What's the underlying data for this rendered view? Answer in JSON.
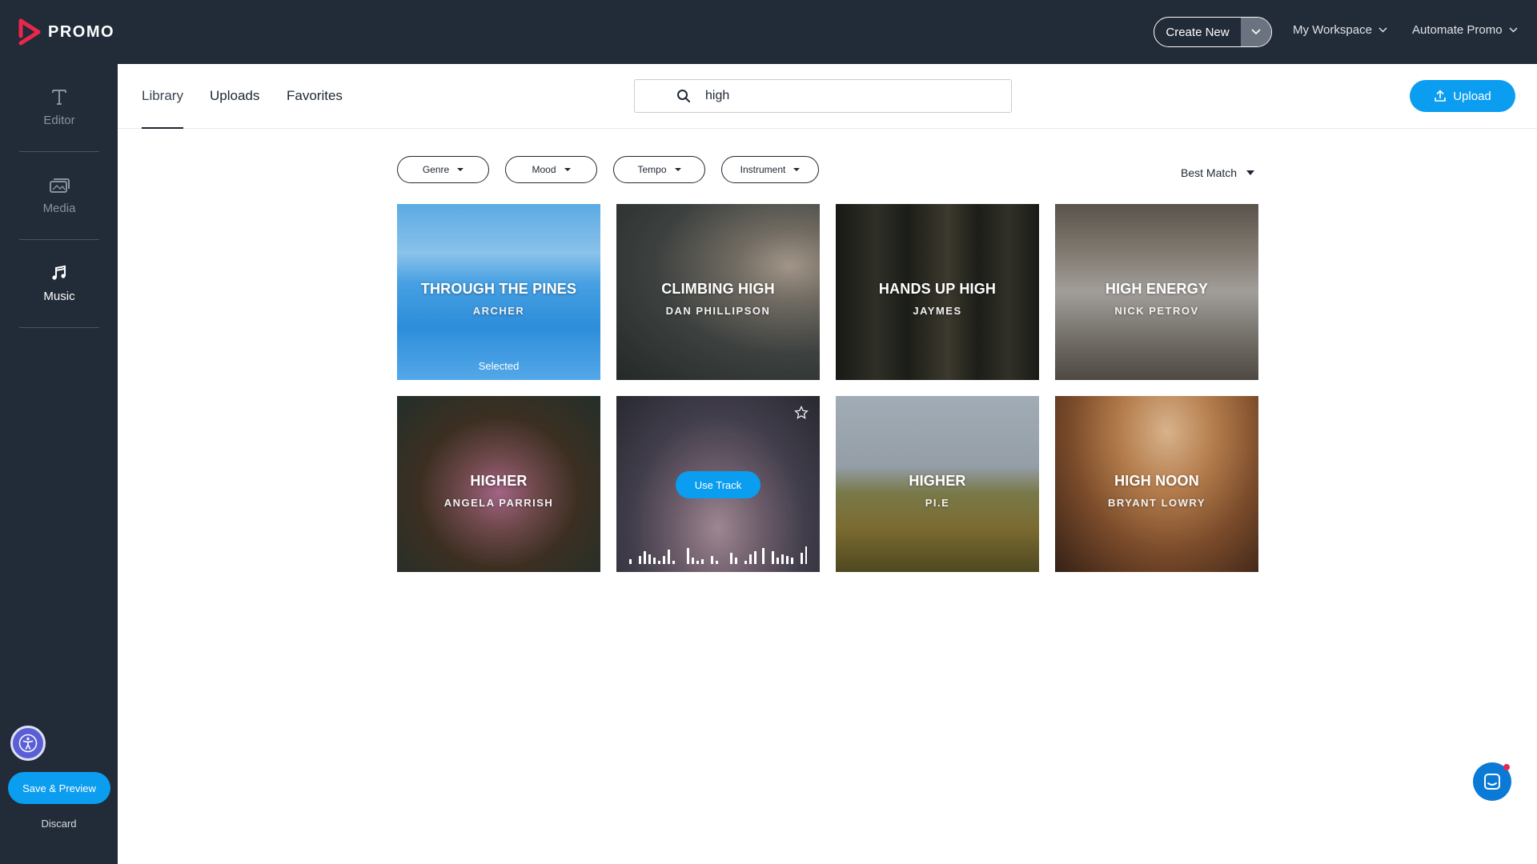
{
  "app": {
    "logo_text": "PROMO"
  },
  "topbar": {
    "create_new": "Create New",
    "workspace": "My Workspace",
    "automate": "Automate Promo"
  },
  "sidebar": {
    "items": [
      {
        "label": "Editor",
        "icon": "text-icon"
      },
      {
        "label": "Media",
        "icon": "media-icon"
      },
      {
        "label": "Music",
        "icon": "music-note-icon"
      }
    ],
    "save_preview": "Save & Preview",
    "discard": "Discard"
  },
  "header": {
    "tabs": [
      "Library",
      "Uploads",
      "Favorites"
    ],
    "active_tab": "Library",
    "search_value": "high",
    "upload": "Upload"
  },
  "filters": {
    "items": [
      "Genre",
      "Mood",
      "Tempo",
      "Instrument"
    ],
    "sort": "Best Match"
  },
  "tracks": [
    {
      "title": "THROUGH THE PINES",
      "artist": "ARCHER",
      "status": "Selected"
    },
    {
      "title": "CLIMBING HIGH",
      "artist": "DAN PHILLIPSON"
    },
    {
      "title": "HANDS UP HIGH",
      "artist": "JAYMES"
    },
    {
      "title": "HIGH ENERGY",
      "artist": "NICK PETROV"
    },
    {
      "title": "HIGHER",
      "artist": "ANGELA PARRISH"
    },
    {
      "action": "Use Track"
    },
    {
      "title": "HIGHER",
      "artist": "PI.E"
    },
    {
      "title": "HIGH NOON",
      "artist": "BRYANT LOWRY"
    }
  ],
  "colors": {
    "dark_bg": "#222b38",
    "accent": "#0b9df0",
    "logo_pink": "#e8284b"
  }
}
